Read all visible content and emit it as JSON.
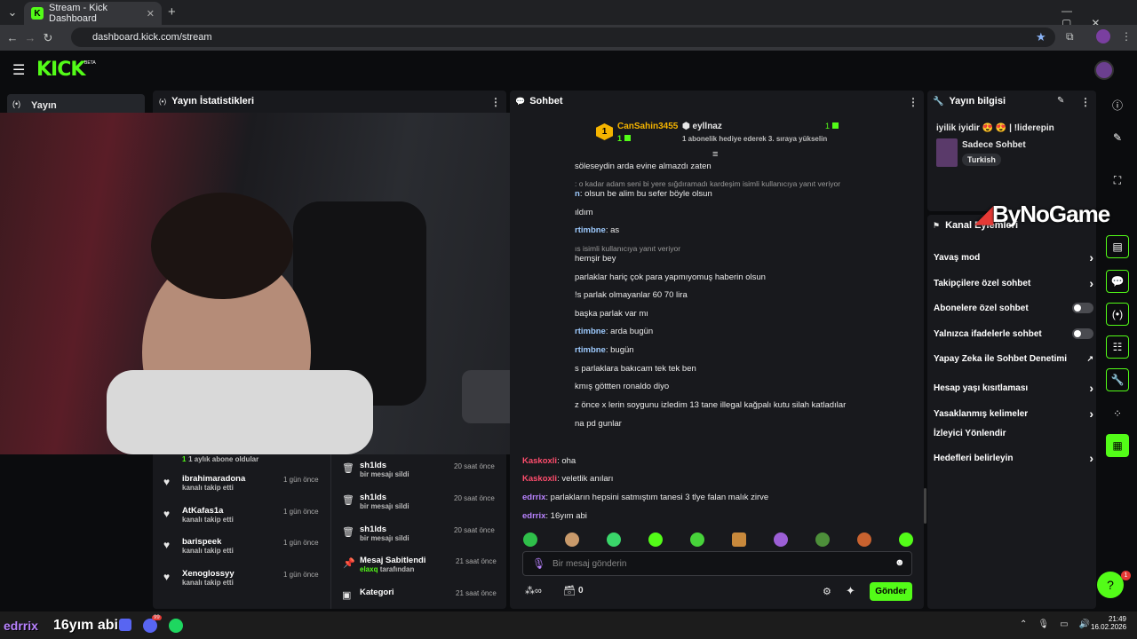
{
  "browser": {
    "tab_title": "Stream - Kick Dashboard",
    "url": "dashboard.kick.com/stream",
    "new_tab": "+"
  },
  "kick": {
    "logo": "KICK",
    "beta": "BETA",
    "sidebar_label": "Yayın"
  },
  "stats_panel": {
    "title": "Yayın İstatistikleri",
    "feed_left": [
      {
        "name": "",
        "sub": "1 aylık abone oldular",
        "time": ""
      },
      {
        "name": "ibrahimaradona",
        "sub": "kanalı takip etti",
        "time": "1 gün önce"
      },
      {
        "name": "AtKafas1a",
        "sub": "kanalı takip etti",
        "time": "1 gün önce"
      },
      {
        "name": "barispeek",
        "sub": "kanalı takip etti",
        "time": "1 gün önce"
      },
      {
        "name": "Xenoglossyy",
        "sub": "kanalı takip etti",
        "time": "1 gün önce"
      }
    ],
    "sub_number": "1",
    "feed_right": [
      {
        "name": "sh1lds",
        "sub": "bir mesajı sildi",
        "time": "20 saat önce"
      },
      {
        "name": "sh1lds",
        "sub": "bir mesajı sildi",
        "time": "20 saat önce"
      },
      {
        "name": "sh1lds",
        "sub": "bir mesajı sildi",
        "time": "20 saat önce"
      },
      {
        "name": "Mesaj Sabitlendi",
        "sub_user": "elaxq",
        "sub": "tarafından",
        "time": "21 saat önce"
      },
      {
        "name": "Kategori",
        "sub": "",
        "time": "21 saat önce"
      }
    ]
  },
  "chat": {
    "title": "Sohbet",
    "top_gifter": {
      "rank": "1",
      "name": "CanSahin3455",
      "count": "1"
    },
    "second": {
      "name": "eyllnaz",
      "count": "1",
      "note": "1 abonelik hediye ederek 3. sıraya yükselin"
    },
    "messages": [
      {
        "user": "",
        "text": "söleseydin arda evine almazdı zaten"
      },
      {
        "user": "",
        "text": ": o kadar adam seni bi yere sığdıramadı kardeşim isimli kullanıcıya yanıt veriyor"
      },
      {
        "user": "n",
        "text": ": olsun be alim bu sefer böyle olsun"
      },
      {
        "user": "",
        "text": "ıldım"
      },
      {
        "user": "rtimbne",
        "text": ": as"
      },
      {
        "user": "",
        "text": "ıs isimli kullanıcıya yanıt veriyor"
      },
      {
        "user": "",
        "text": " hemşir bey"
      },
      {
        "user": "",
        "text": "parlaklar hariç çok para yapmıyomuş haberin olsun"
      },
      {
        "user": "",
        "text": " !s parlak olmayanlar 60 70 lira"
      },
      {
        "user": "",
        "text": "başka parlak var mı"
      },
      {
        "user": "rtimbne",
        "text": ": arda bugün"
      },
      {
        "user": "rtimbne",
        "text": ": bugün"
      },
      {
        "user": "",
        "text": "s parlaklara bakıcam tek tek ben"
      },
      {
        "user": "",
        "text": "kmış göttten ronaldo diyo"
      },
      {
        "user": "",
        "text": "z önce x lerin soygunu izledim 13 tane illegal kağpalı kutu silah katladılar"
      },
      {
        "user": "",
        "text": "na pd gunlar"
      }
    ],
    "bottom_messages": [
      {
        "user": "Kaskoxli",
        "text": ": oha"
      },
      {
        "user": "Kaskoxli",
        "text": ": veletlik anıları"
      },
      {
        "user": "edrrix",
        "text": ": parlakların hepsini satmıştım tanesi 3 tlye falan malık zirve"
      },
      {
        "user": "edrrix",
        "text": ": 16yım abi"
      }
    ],
    "input_placeholder": "Bir mesaj gönderin",
    "points_value": "0",
    "send_label": "Gönder"
  },
  "info_panel": {
    "title": "Yayın bilgisi",
    "stream_title": "iyilik iyidir 😍 😍 | !liderepin",
    "category": "Sadece Sohbet",
    "language": "Turkish"
  },
  "actions_panel": {
    "title": "Kanal Eylemleri",
    "items": [
      {
        "label": "Yavaş mod",
        "kind": "chevron"
      },
      {
        "label": "Takipçilere özel sohbet",
        "kind": "chevron"
      },
      {
        "label": "Abonelere özel sohbet",
        "kind": "toggle"
      },
      {
        "label": "Yalnızca ifadelerle sohbet",
        "kind": "toggle"
      },
      {
        "label": "Yapay Zeka ile Sohbet Denetimi",
        "kind": "external"
      },
      {
        "label": "Hesap yaşı kısıtlaması",
        "kind": "chevron"
      },
      {
        "label": "Yasaklanmış kelimeler",
        "kind": "chevron"
      },
      {
        "label": "İzleyici Yönlendir",
        "kind": "none"
      },
      {
        "label": "Hedefleri belirleyin",
        "kind": "chevron"
      }
    ]
  },
  "watermark": "ByNoGame",
  "overlay_text": {
    "user": "edrrix",
    "text": "16yım abi"
  },
  "help_badge": "1",
  "taskbar": {
    "time": "21:49",
    "date": "16.02.2026",
    "discord_badge": "99"
  },
  "colors": {
    "kick_green": "#53fc18",
    "panel": "#18191d",
    "bg": "#0b0c0e",
    "red_user": "#ff4d6d",
    "purple_user": "#b983ff"
  }
}
